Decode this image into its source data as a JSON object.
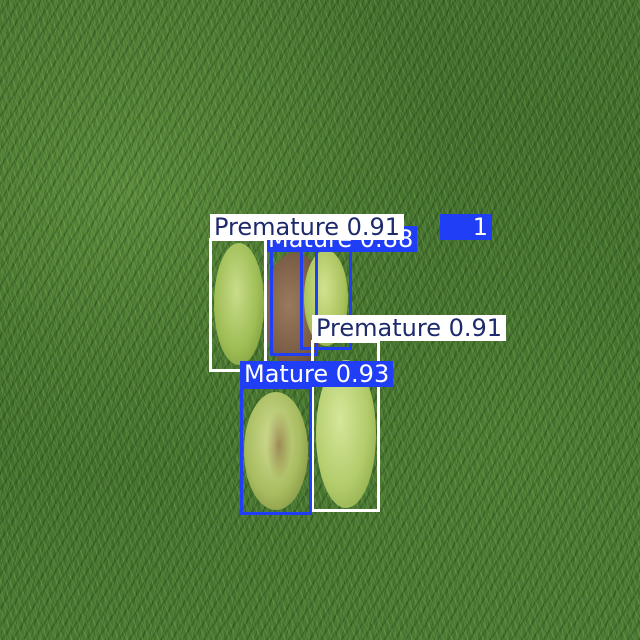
{
  "detections": [
    {
      "id": "d1",
      "label": "Premature 0.91",
      "class": "Premature",
      "color": "#ffffff"
    },
    {
      "id": "d2",
      "label": "Mature 0.88",
      "class": "Mature",
      "color": "#1f3ef5"
    },
    {
      "id": "d3",
      "label": "Premature 0.91",
      "class": "Premature",
      "color": "#ffffff"
    },
    {
      "id": "d4",
      "label": "Mature 0.93",
      "class": "Mature",
      "color": "#1f3ef5"
    },
    {
      "id": "d5",
      "label": "Premature 0.91",
      "class": "Premature",
      "color": "#ffffff"
    }
  ],
  "colors": {
    "premature": "#ffffff",
    "mature": "#1f3ef5",
    "label_text_dark": "#1d2a6b"
  }
}
